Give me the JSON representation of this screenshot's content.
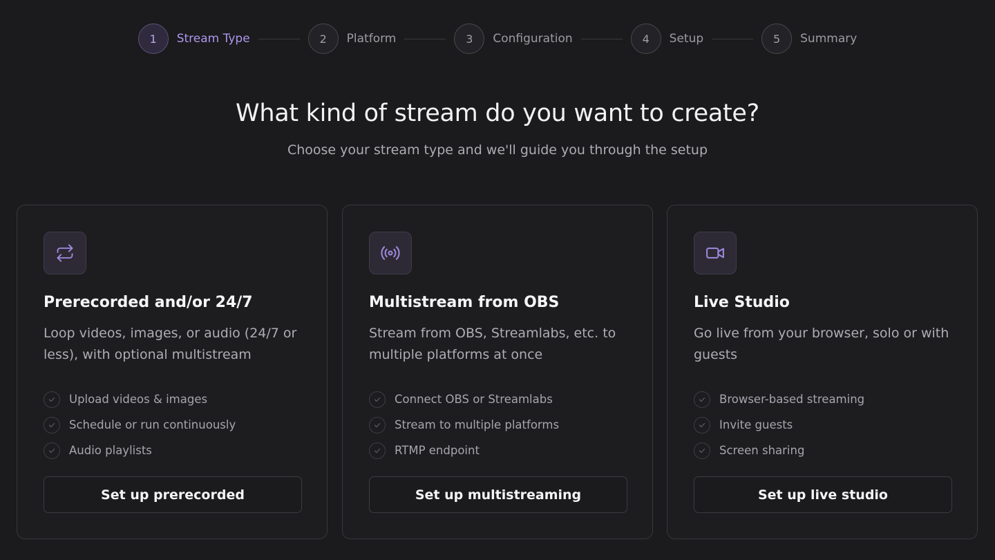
{
  "stepper": {
    "steps": [
      {
        "number": "1",
        "label": "Stream Type",
        "active": true
      },
      {
        "number": "2",
        "label": "Platform",
        "active": false
      },
      {
        "number": "3",
        "label": "Configuration",
        "active": false
      },
      {
        "number": "4",
        "label": "Setup",
        "active": false
      },
      {
        "number": "5",
        "label": "Summary",
        "active": false
      }
    ]
  },
  "header": {
    "title": "What kind of stream do you want to create?",
    "subtitle": "Choose your stream type and we'll guide you through the setup"
  },
  "colors": {
    "background": "#1b1a1c",
    "accent": "#ac97ee",
    "icon_tile": "#2d2a35"
  },
  "cards": [
    {
      "icon": "repeat-icon",
      "title": "Prerecorded and/or 24/7",
      "description": "Loop videos, images, or audio (24/7 or less), with optional multistream",
      "features": [
        "Upload videos & images",
        "Schedule or run continuously",
        "Audio playlists"
      ],
      "button": "Set up prerecorded"
    },
    {
      "icon": "broadcast-icon",
      "title": "Multistream from OBS",
      "description": "Stream from OBS, Streamlabs, etc. to multiple platforms at once",
      "features": [
        "Connect OBS or Streamlabs",
        "Stream to multiple platforms",
        "RTMP endpoint"
      ],
      "button": "Set up multistreaming"
    },
    {
      "icon": "video-camera-icon",
      "title": "Live Studio",
      "description": "Go live from your browser, solo or with guests",
      "features": [
        "Browser-based streaming",
        "Invite guests",
        "Screen sharing"
      ],
      "button": "Set up live studio"
    }
  ]
}
